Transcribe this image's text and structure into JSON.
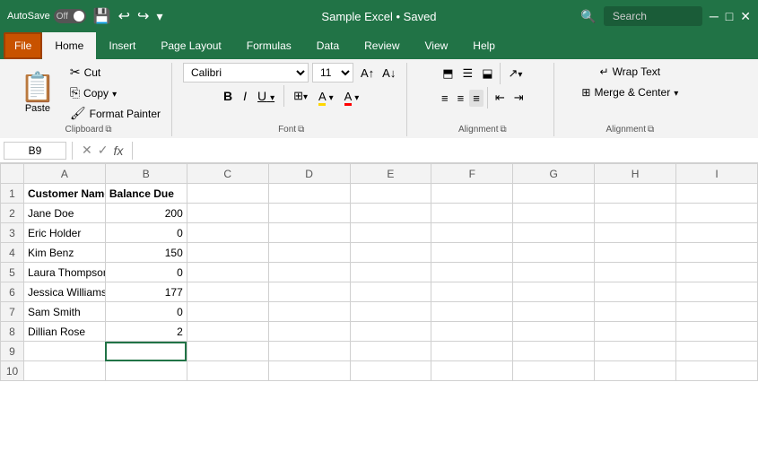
{
  "titleBar": {
    "autosave_label": "AutoSave",
    "toggle_state": "Off",
    "title": "Sample Excel • Saved",
    "search_placeholder": "Search"
  },
  "tabs": {
    "file": "File",
    "home": "Home",
    "insert": "Insert",
    "pageLayout": "Page Layout",
    "formulas": "Formulas",
    "data": "Data",
    "review": "Review",
    "view": "View",
    "help": "Help"
  },
  "clipboard": {
    "paste": "Paste",
    "cut": "Cut",
    "copy": "Copy",
    "formatPainter": "Format Painter",
    "label": "Clipboard"
  },
  "font": {
    "name": "Calibri",
    "size": "11",
    "bold": "B",
    "italic": "I",
    "underline": "U",
    "label": "Font"
  },
  "alignment": {
    "label": "Alignment",
    "wrapText": "Wrap Text",
    "mergeCenter": "Merge & Center"
  },
  "formulaBar": {
    "cellRef": "B9",
    "cancelSymbol": "✕",
    "confirmSymbol": "✓",
    "functionSymbol": "fx"
  },
  "columns": [
    "A",
    "B",
    "C",
    "D",
    "E",
    "F",
    "G",
    "H",
    "I"
  ],
  "rows": [
    {
      "id": 1,
      "cells": [
        {
          "val": "Customer Name",
          "bold": true
        },
        {
          "val": "Balance Due",
          "bold": true
        },
        {
          "val": ""
        },
        {
          "val": ""
        },
        {
          "val": ""
        },
        {
          "val": ""
        },
        {
          "val": ""
        },
        {
          "val": ""
        },
        {
          "val": ""
        }
      ]
    },
    {
      "id": 2,
      "cells": [
        {
          "val": "Jane Doe"
        },
        {
          "val": "200",
          "num": true
        },
        {
          "val": ""
        },
        {
          "val": ""
        },
        {
          "val": ""
        },
        {
          "val": ""
        },
        {
          "val": ""
        },
        {
          "val": ""
        },
        {
          "val": ""
        }
      ]
    },
    {
      "id": 3,
      "cells": [
        {
          "val": "Eric Holder"
        },
        {
          "val": "0",
          "num": true
        },
        {
          "val": ""
        },
        {
          "val": ""
        },
        {
          "val": ""
        },
        {
          "val": ""
        },
        {
          "val": ""
        },
        {
          "val": ""
        },
        {
          "val": ""
        }
      ]
    },
    {
      "id": 4,
      "cells": [
        {
          "val": "Kim Benz"
        },
        {
          "val": "150",
          "num": true
        },
        {
          "val": ""
        },
        {
          "val": ""
        },
        {
          "val": ""
        },
        {
          "val": ""
        },
        {
          "val": ""
        },
        {
          "val": ""
        },
        {
          "val": ""
        }
      ]
    },
    {
      "id": 5,
      "cells": [
        {
          "val": "Laura Thompson"
        },
        {
          "val": "0",
          "num": true
        },
        {
          "val": ""
        },
        {
          "val": ""
        },
        {
          "val": ""
        },
        {
          "val": ""
        },
        {
          "val": ""
        },
        {
          "val": ""
        },
        {
          "val": ""
        }
      ]
    },
    {
      "id": 6,
      "cells": [
        {
          "val": "Jessica Williams"
        },
        {
          "val": "177",
          "num": true
        },
        {
          "val": ""
        },
        {
          "val": ""
        },
        {
          "val": ""
        },
        {
          "val": ""
        },
        {
          "val": ""
        },
        {
          "val": ""
        },
        {
          "val": ""
        }
      ]
    },
    {
      "id": 7,
      "cells": [
        {
          "val": "Sam Smith"
        },
        {
          "val": "0",
          "num": true
        },
        {
          "val": ""
        },
        {
          "val": ""
        },
        {
          "val": ""
        },
        {
          "val": ""
        },
        {
          "val": ""
        },
        {
          "val": ""
        },
        {
          "val": ""
        }
      ]
    },
    {
      "id": 8,
      "cells": [
        {
          "val": "Dillian Rose"
        },
        {
          "val": "2",
          "num": true
        },
        {
          "val": ""
        },
        {
          "val": ""
        },
        {
          "val": ""
        },
        {
          "val": ""
        },
        {
          "val": ""
        },
        {
          "val": ""
        },
        {
          "val": ""
        }
      ]
    },
    {
      "id": 9,
      "cells": [
        {
          "val": ""
        },
        {
          "val": ""
        },
        {
          "val": ""
        },
        {
          "val": ""
        },
        {
          "val": ""
        },
        {
          "val": ""
        },
        {
          "val": ""
        },
        {
          "val": ""
        },
        {
          "val": ""
        }
      ]
    },
    {
      "id": 10,
      "cells": [
        {
          "val": ""
        },
        {
          "val": ""
        },
        {
          "val": ""
        },
        {
          "val": ""
        },
        {
          "val": ""
        },
        {
          "val": ""
        },
        {
          "val": ""
        },
        {
          "val": ""
        },
        {
          "val": ""
        }
      ]
    }
  ],
  "selectedCell": "B9"
}
